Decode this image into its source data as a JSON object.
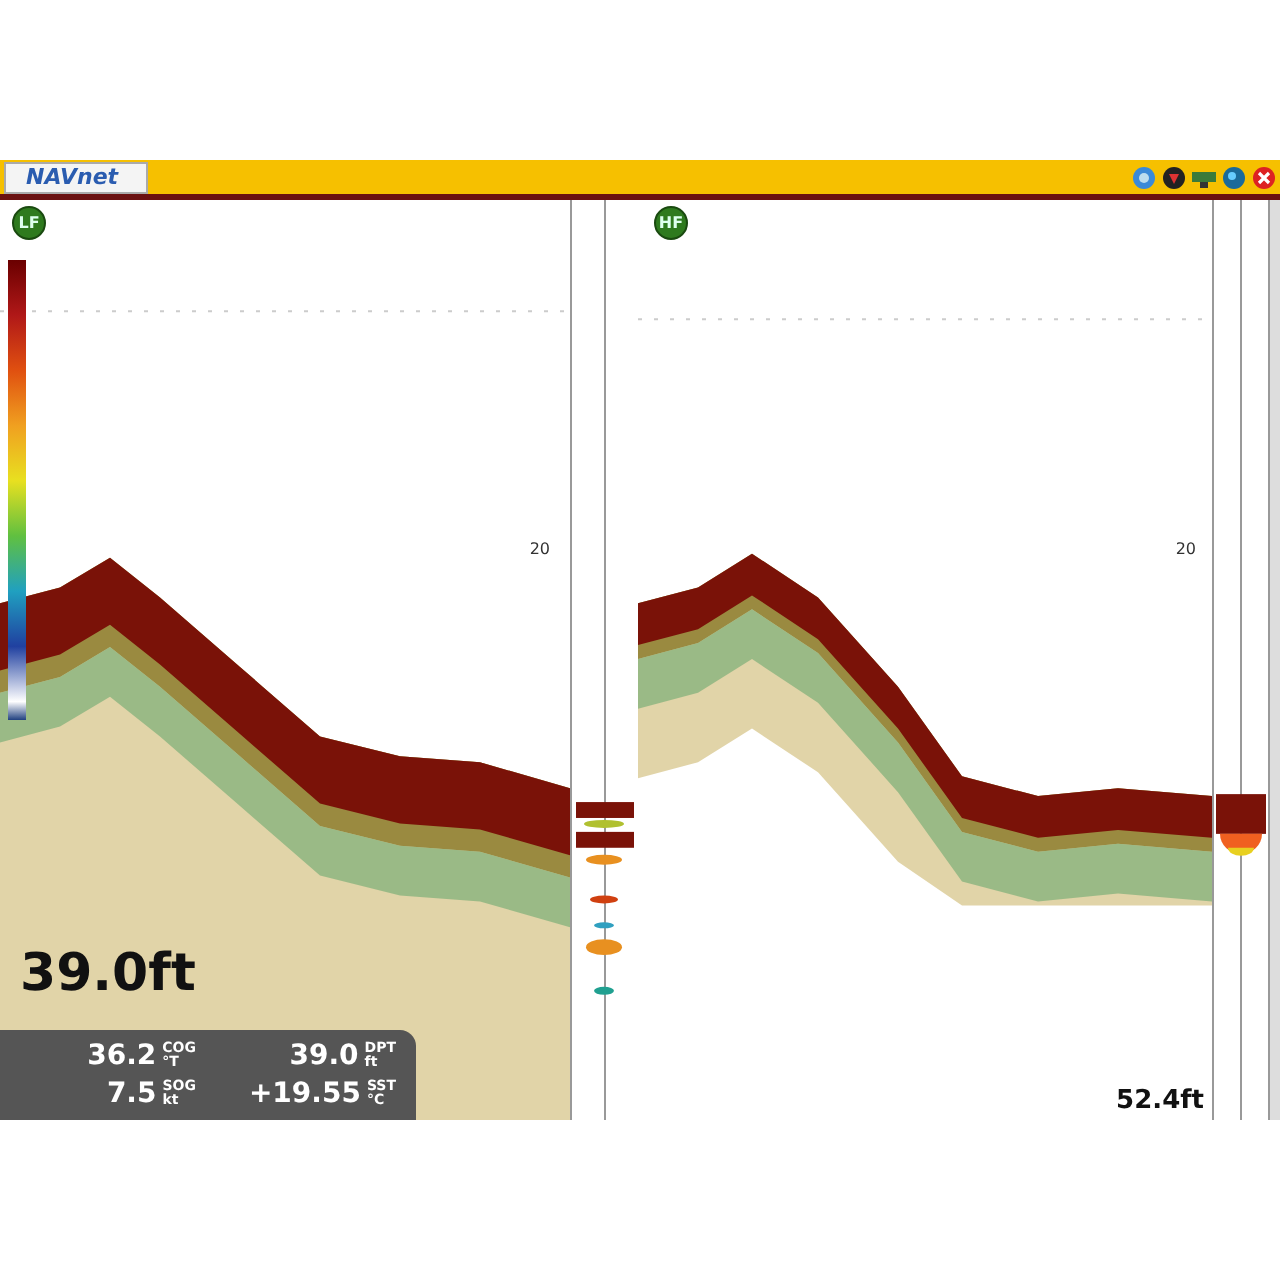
{
  "toolbar": {
    "logo": "NAVnet"
  },
  "panels": [
    {
      "frequency": "LF",
      "scale_label": "20",
      "depth_reading": "39.0ft"
    },
    {
      "frequency": "HF",
      "scale_label": "20",
      "depth_reading": "52.4ft"
    }
  ],
  "data_box": {
    "items": [
      {
        "value": "36.2",
        "label": "COG",
        "unit": "°T"
      },
      {
        "value": "39.0",
        "label": "DPT",
        "unit": "ft"
      },
      {
        "value": "7.5",
        "label": "SOG",
        "unit": "kt"
      },
      {
        "value": "+19.55",
        "label": "SST",
        "unit": "°C"
      }
    ]
  }
}
